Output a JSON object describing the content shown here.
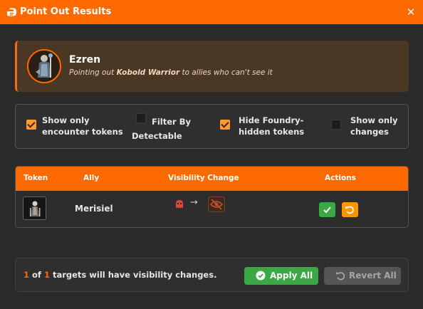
{
  "window": {
    "title": "Point Out Results",
    "close_glyph": "✕"
  },
  "observer": {
    "name": "Ezren",
    "desc_prefix": "Pointing out ",
    "target": "Kobold Warrior",
    "desc_suffix": " to allies who can't see it"
  },
  "filters": [
    {
      "label_line1": "Show only",
      "label_line2": "encounter tokens",
      "checked": true
    },
    {
      "label_line1": "Filter By",
      "label_line2": "Detectable",
      "checked": false
    },
    {
      "label_line1": "Hide Foundry-",
      "label_line2": "hidden tokens",
      "checked": true
    },
    {
      "label_line1": "Show only",
      "label_line2": "changes",
      "checked": false
    }
  ],
  "table": {
    "headers": {
      "token": "Token",
      "ally": "Ally",
      "visibility": "Visibility Change",
      "actions": "Actions"
    },
    "rows": [
      {
        "ally": "Merisiel",
        "from_state_icon": "ghost-icon",
        "to_state_icon": "eye-slash-icon",
        "arrow": "→"
      }
    ]
  },
  "footer": {
    "changed": "1",
    "of": " of ",
    "total": "1",
    "suffix": " targets will have visibility changes.",
    "apply_label": "Apply All",
    "revert_label": "Revert All"
  },
  "colors": {
    "accent": "#ff6a00",
    "apply": "#3aa845",
    "revert_row": "#ff9500",
    "hidden_state": "#e0473a"
  }
}
